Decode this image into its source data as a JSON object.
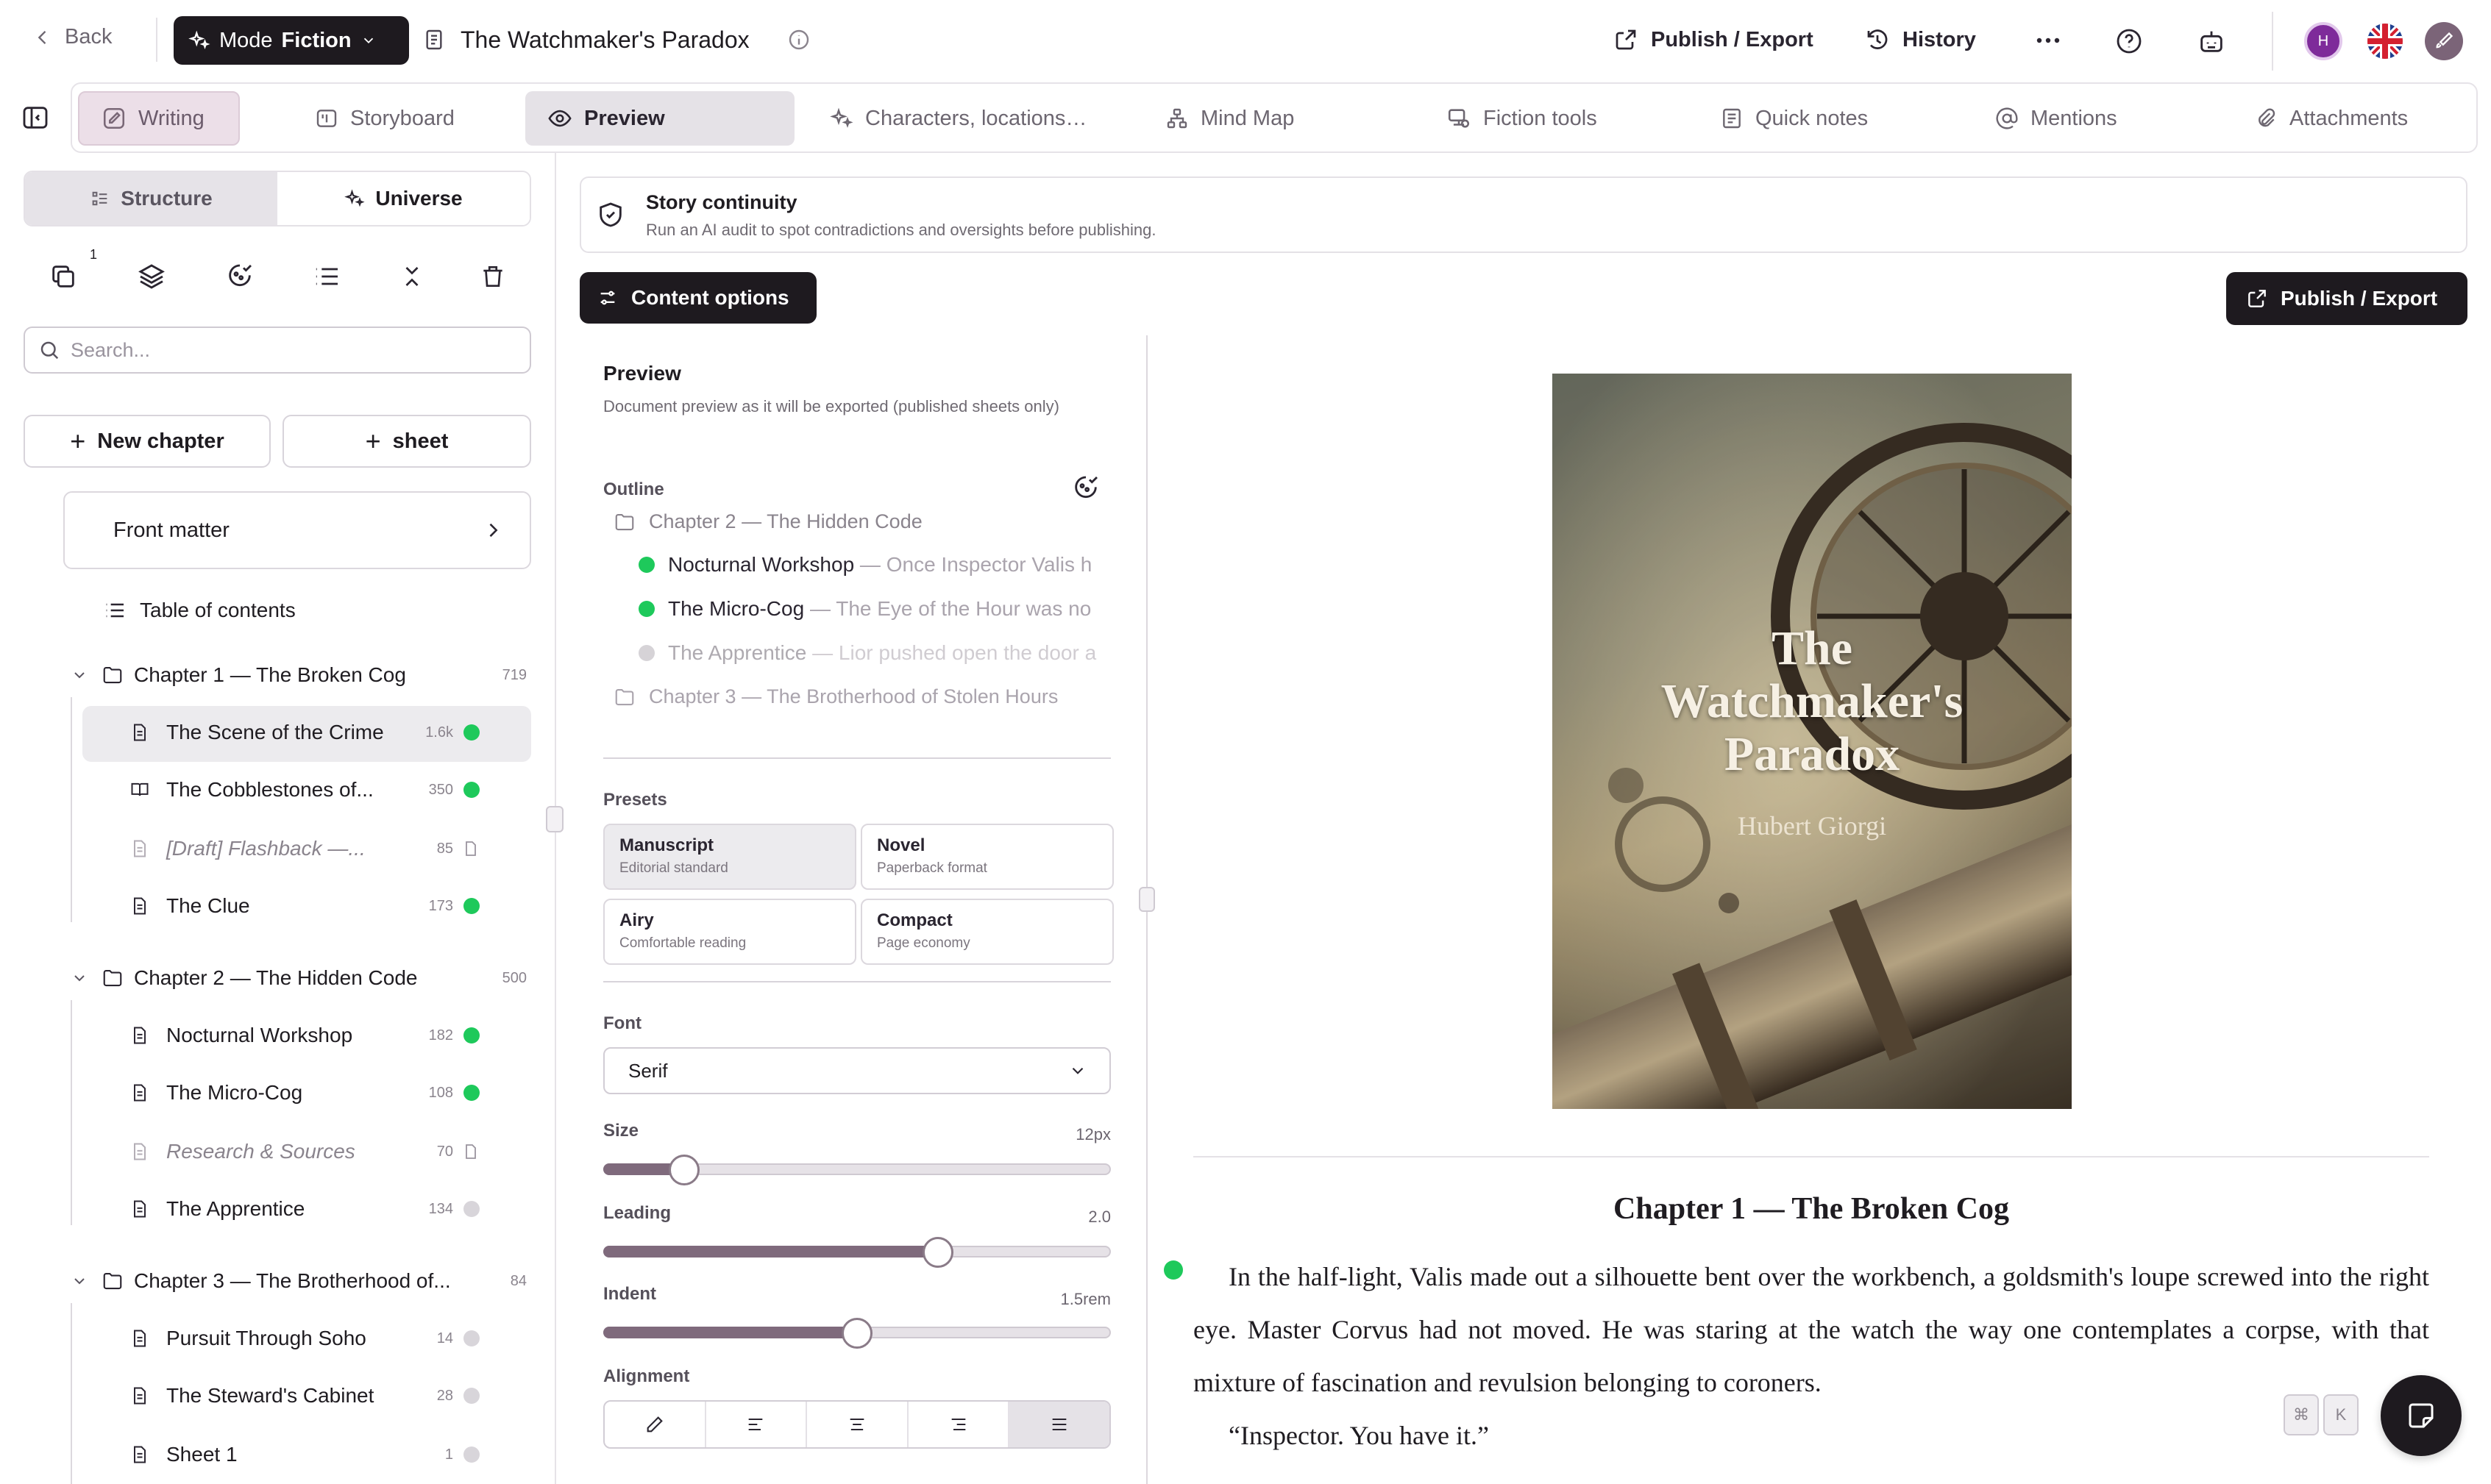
{
  "topbar": {
    "back": "Back",
    "mode_prefix": "Mode",
    "mode_value": "Fiction",
    "doc_title": "The Watchmaker's Paradox",
    "publish_export": "Publish / Export",
    "history": "History",
    "avatar_initial": "H"
  },
  "tabs": [
    {
      "label": "Writing"
    },
    {
      "label": "Storyboard"
    },
    {
      "label": "Preview"
    },
    {
      "label": "Characters, locations…"
    },
    {
      "label": "Mind Map"
    },
    {
      "label": "Fiction tools"
    },
    {
      "label": "Quick notes"
    },
    {
      "label": "Mentions"
    },
    {
      "label": "Attachments"
    }
  ],
  "sidebar": {
    "seg_structure": "Structure",
    "seg_universe": "Universe",
    "tool_badge": "1",
    "search_placeholder": "Search...",
    "new_chapter": "New chapter",
    "new_sheet": "sheet",
    "front_matter": "Front matter",
    "toc": "Table of contents",
    "chapters": [
      {
        "title": "Chapter 1 — The Broken Cog",
        "count": "719"
      },
      {
        "title": "Chapter 2 — The Hidden Code",
        "count": "500"
      },
      {
        "title": "Chapter 3 — The Brotherhood of...",
        "count": "84"
      }
    ],
    "sheets": [
      {
        "title": "The Scene of the Crime",
        "count": "1.6k",
        "status": "green"
      },
      {
        "title": "The Cobblestones of...",
        "count": "350",
        "status": "green"
      },
      {
        "title": "[Draft] Flashback —...",
        "count": "85",
        "status": "file"
      },
      {
        "title": "The Clue",
        "count": "173",
        "status": "green"
      },
      {
        "title": "Nocturnal Workshop",
        "count": "182",
        "status": "green"
      },
      {
        "title": "The Micro-Cog",
        "count": "108",
        "status": "green"
      },
      {
        "title": "Research & Sources",
        "count": "70",
        "status": "file"
      },
      {
        "title": "The Apprentice",
        "count": "134",
        "status": "grey"
      },
      {
        "title": "Pursuit Through Soho",
        "count": "14",
        "status": "grey"
      },
      {
        "title": "The Steward's Cabinet",
        "count": "28",
        "status": "grey"
      },
      {
        "title": "Sheet 1",
        "count": "1",
        "status": "grey"
      }
    ]
  },
  "continuity": {
    "title": "Story continuity",
    "subtitle": "Run an AI audit to spot contradictions and oversights before publishing."
  },
  "content_options": "Content options",
  "publish_export_btn": "Publish / Export",
  "options": {
    "preview_title": "Preview",
    "preview_desc": "Document preview as it will be exported (published sheets only)",
    "outline_label": "Outline",
    "outline": [
      {
        "title": "Chapter 2 — The Hidden Code",
        "excerpt": ""
      },
      {
        "title": "Nocturnal Workshop",
        "excerpt": " — Once Inspector Valis h"
      },
      {
        "title": "The Micro-Cog",
        "excerpt": " — The Eye of the Hour was no"
      },
      {
        "title": "The Apprentice",
        "excerpt": " — Lior pushed open the door a"
      },
      {
        "title": "Chapter 3 — The Brotherhood of Stolen Hours",
        "excerpt": ""
      }
    ],
    "presets_label": "Presets",
    "presets": [
      {
        "name": "Manuscript",
        "desc": "Editorial standard"
      },
      {
        "name": "Novel",
        "desc": "Paperback format"
      },
      {
        "name": "Airy",
        "desc": "Comfortable reading"
      },
      {
        "name": "Compact",
        "desc": "Page economy"
      }
    ],
    "font_label": "Font",
    "font_value": "Serif",
    "size_label": "Size",
    "size_value": "12px",
    "size_fraction": 0.16,
    "leading_label": "Leading",
    "leading_value": "2.0",
    "leading_fraction": 0.66,
    "indent_label": "Indent",
    "indent_value": "1.5rem",
    "indent_fraction": 0.5,
    "alignment_label": "Alignment"
  },
  "preview": {
    "cover_title_1": "The",
    "cover_title_2": "Watchmaker's",
    "cover_title_3": "Paradox",
    "cover_author": "Hubert Giorgi",
    "chapter_heading": "Chapter 1 — The Broken Cog",
    "para_1": "In the half-light, Valis made out a silhouette bent over the workbench, a goldsmith's loupe screwed into the right eye. Master Corvus had not moved. He was staring at the watch the way one contemplates a corpse, with that mixture of fascination and revulsion belonging to coroners.",
    "para_2": "“Inspector. You have it.”",
    "kbd_1": "⌘",
    "kbd_2": "K"
  }
}
